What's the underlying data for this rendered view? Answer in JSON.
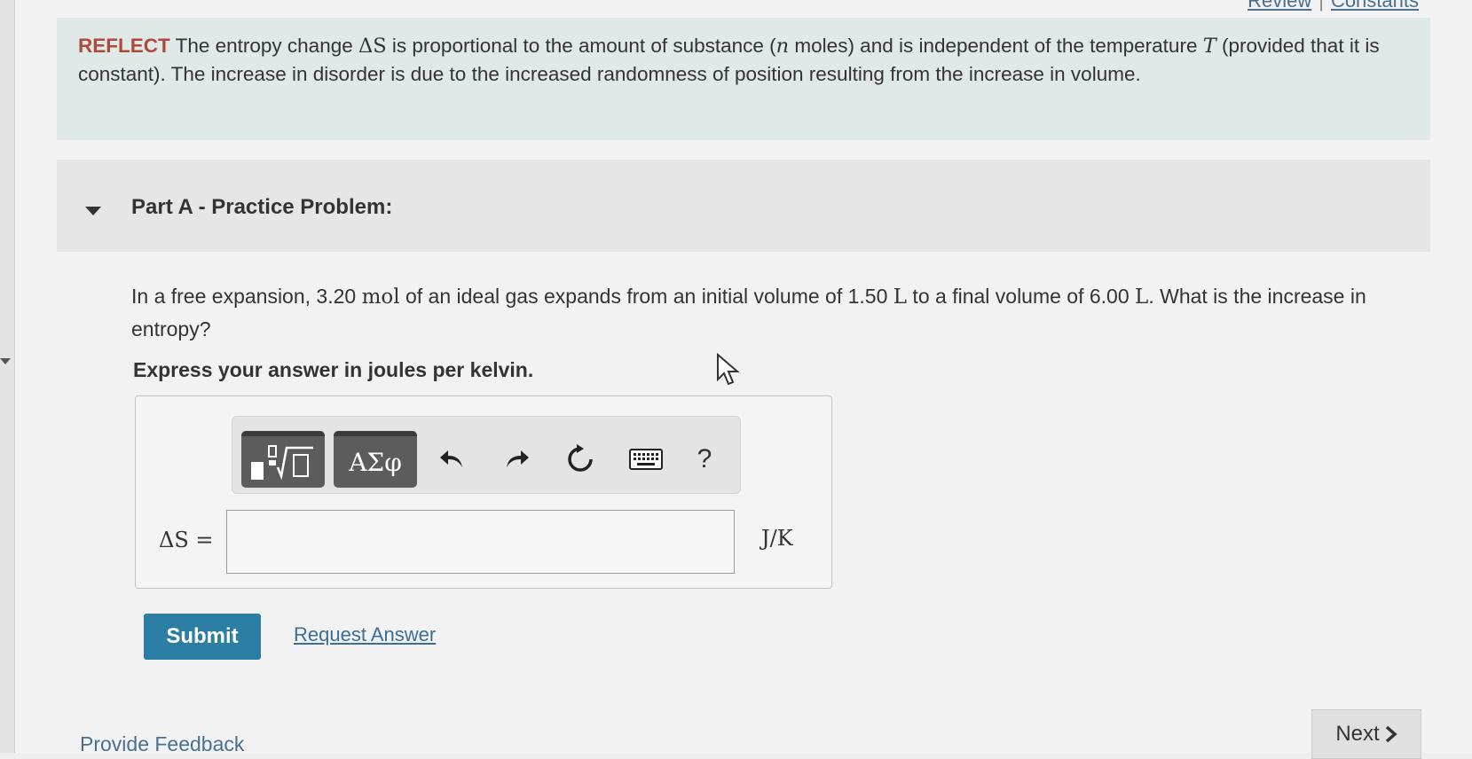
{
  "header": {
    "review_link": "Review",
    "constants_link": "Constants"
  },
  "reflect": {
    "label": "REFLECT",
    "text_1": " The entropy change ",
    "delta_s": "ΔS",
    "text_2": " is proportional to the amount of substance (",
    "n": "n",
    "text_3": " moles) and is independent of the temperature ",
    "t": "T",
    "text_4": " (provided that it is constant). The increase in disorder is due to the increased randomness of position resulting from the increase in volume."
  },
  "part": {
    "title": "Part A - Practice Problem:"
  },
  "question": {
    "text_1": "In a free expansion, 3.20 ",
    "unit_mol": "mol",
    "text_2": " of an ideal gas expands from an initial volume of 1.50 ",
    "unit_l1": "L",
    "text_3": " to a final volume of 6.00 ",
    "unit_l2": "L",
    "text_4": ". What is the increase in entropy?"
  },
  "instruction": "Express your answer in joules per kelvin.",
  "toolbar": {
    "symbols_label": "ΑΣφ",
    "help_label": "?"
  },
  "answer": {
    "variable_label": "ΔS =",
    "value": "",
    "unit": "J/K"
  },
  "actions": {
    "submit_label": "Submit",
    "request_answer_label": "Request Answer",
    "feedback_label": "Provide Feedback",
    "next_label": "Next"
  }
}
